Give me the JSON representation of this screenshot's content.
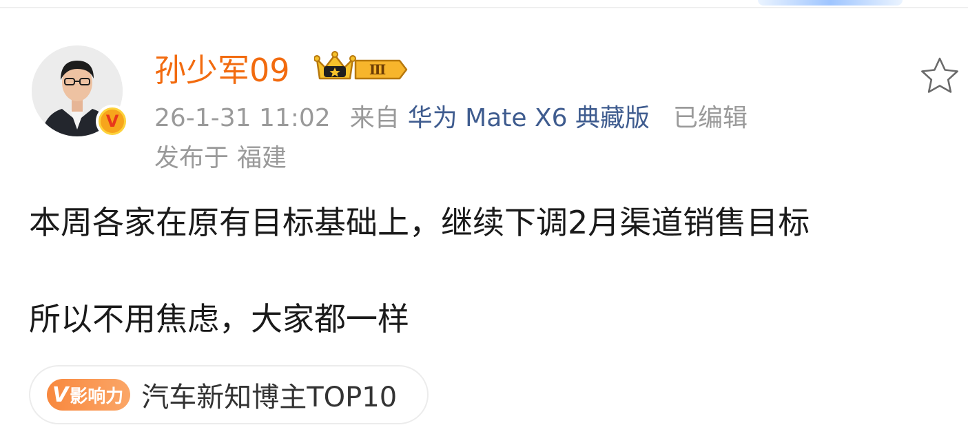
{
  "post": {
    "author": {
      "name": "孙少军09",
      "level_badge": "Ⅲ",
      "verified_mark": "V"
    },
    "meta": {
      "time": "26-1-31 11:02",
      "from_label": "来自",
      "device": "华为 Mate X6 典藏版",
      "edited": "已编辑"
    },
    "location": {
      "prefix": "发布于",
      "place": "福建"
    },
    "content": {
      "line1": "本周各家在原有目标基础上，继续下调2月渠道销售目标",
      "line2": "所以不用焦虑，大家都一样"
    },
    "influence_tag": {
      "badge_v": "V",
      "badge_word": "影响力",
      "text": "汽车新知博主TOP10"
    }
  },
  "icons": {
    "favorite": "star-outline-icon",
    "crown": "crown-icon",
    "verified": "verified-v-icon"
  },
  "colors": {
    "username": "#f26b0f",
    "device_link": "#3f5c8f",
    "meta_text": "#9a9a9a",
    "body_text": "#1a1a1a",
    "influence_badge": "#f8883e",
    "verified_badge": "#f7a51c"
  }
}
